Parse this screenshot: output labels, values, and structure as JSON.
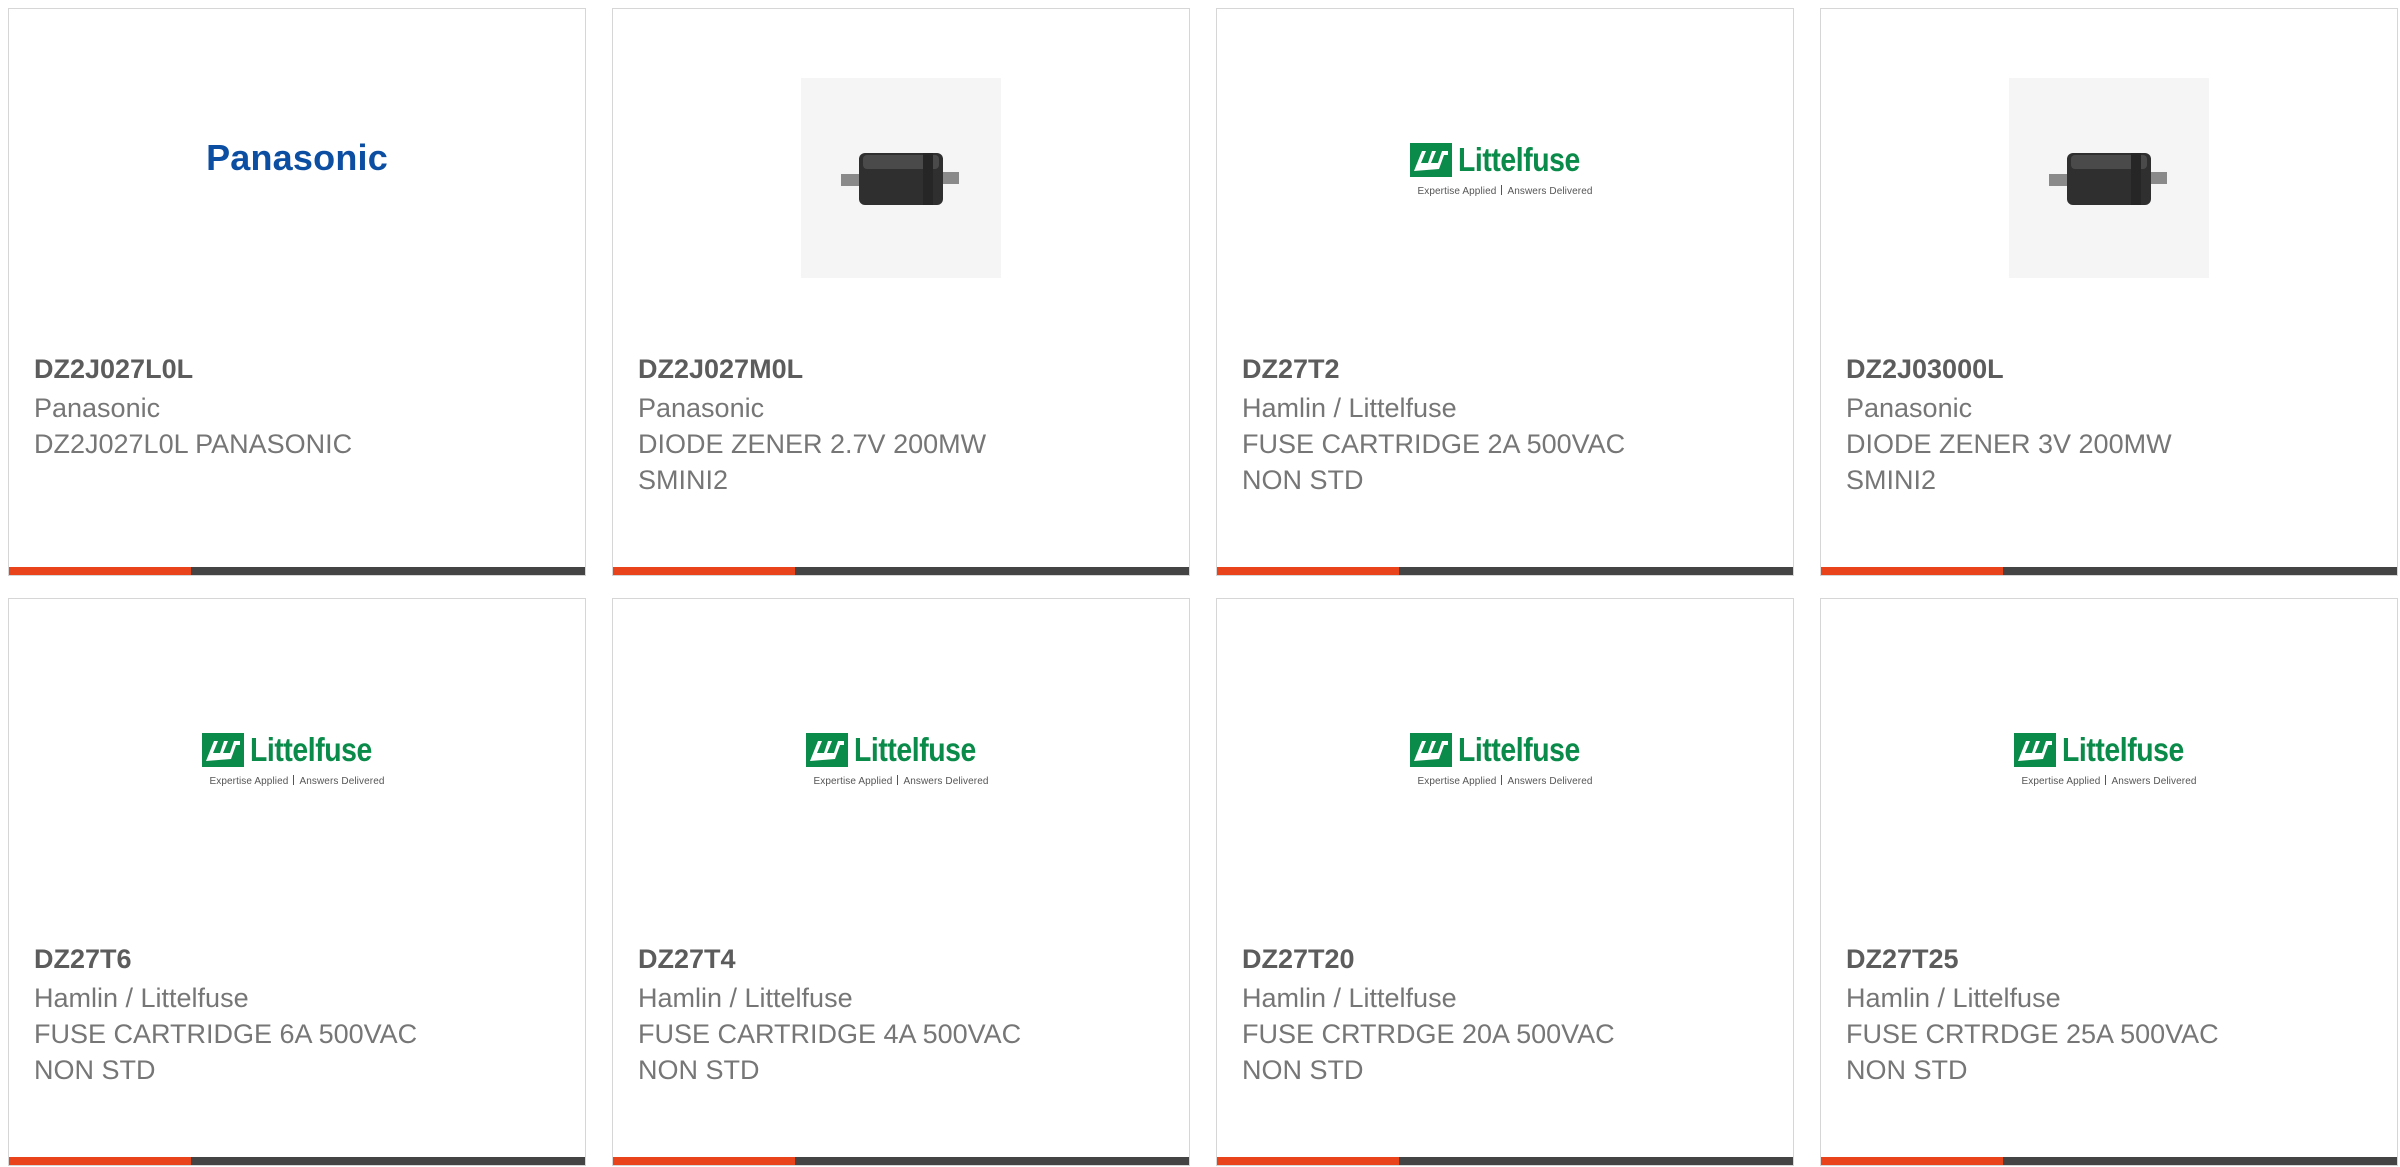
{
  "products": [
    {
      "part_number": "DZ2J027L0L",
      "manufacturer": "Panasonic",
      "description_lines": [
        "DZ2J027L0L PANASONIC"
      ],
      "image": "panasonic-logo",
      "logo_text": "Panasonic"
    },
    {
      "part_number": "DZ2J027M0L",
      "manufacturer": "Panasonic",
      "description_lines": [
        "DIODE ZENER 2.7V 200MW",
        "SMINI2"
      ],
      "image": "diode-photo"
    },
    {
      "part_number": "DZ27T2",
      "manufacturer": "Hamlin / Littelfuse",
      "description_lines": [
        "FUSE CARTRIDGE 2A 500VAC",
        "NON STD"
      ],
      "image": "littelfuse-logo",
      "logo_text": "Littelfuse",
      "logo_tagline": [
        "Expertise Applied",
        "Answers Delivered"
      ]
    },
    {
      "part_number": "DZ2J03000L",
      "manufacturer": "Panasonic",
      "description_lines": [
        "DIODE ZENER 3V 200MW",
        "SMINI2"
      ],
      "image": "diode-photo"
    },
    {
      "part_number": "DZ27T6",
      "manufacturer": "Hamlin / Littelfuse",
      "description_lines": [
        "FUSE CARTRIDGE 6A 500VAC",
        "NON STD"
      ],
      "image": "littelfuse-logo",
      "logo_text": "Littelfuse",
      "logo_tagline": [
        "Expertise Applied",
        "Answers Delivered"
      ]
    },
    {
      "part_number": "DZ27T4",
      "manufacturer": "Hamlin / Littelfuse",
      "description_lines": [
        "FUSE CARTRIDGE 4A 500VAC",
        "NON STD"
      ],
      "image": "littelfuse-logo",
      "logo_text": "Littelfuse",
      "logo_tagline": [
        "Expertise Applied",
        "Answers Delivered"
      ]
    },
    {
      "part_number": "DZ27T20",
      "manufacturer": "Hamlin / Littelfuse",
      "description_lines": [
        "FUSE CRTRDGE 20A 500VAC",
        "NON STD"
      ],
      "image": "littelfuse-logo",
      "logo_text": "Littelfuse",
      "logo_tagline": [
        "Expertise Applied",
        "Answers Delivered"
      ]
    },
    {
      "part_number": "DZ27T25",
      "manufacturer": "Hamlin / Littelfuse",
      "description_lines": [
        "FUSE CRTRDGE 25A 500VAC",
        "NON STD"
      ],
      "image": "littelfuse-logo",
      "logo_text": "Littelfuse",
      "logo_tagline": [
        "Expertise Applied",
        "Answers Delivered"
      ]
    }
  ],
  "colors": {
    "accent": "#e8431b",
    "bar": "#444444",
    "border": "#d6d6d6",
    "part_number_text": "#5c5c5c",
    "body_text": "#767676",
    "panasonic_blue": "#0b4ea2",
    "littelfuse_green": "#0a8b4a"
  }
}
